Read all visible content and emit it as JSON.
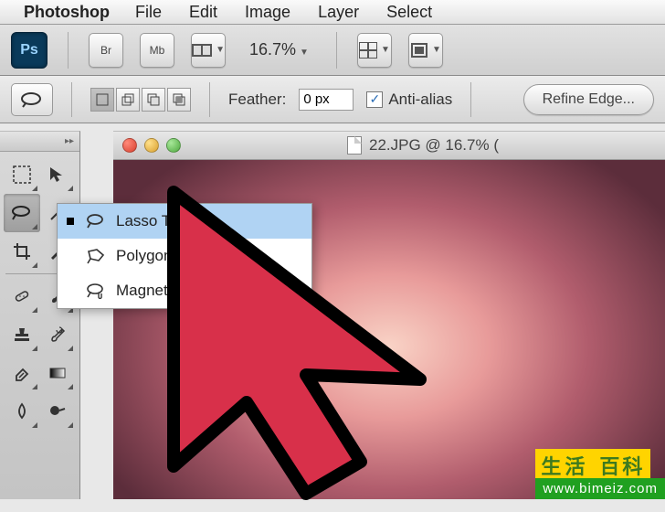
{
  "menubar": {
    "app": "Photoshop",
    "items": [
      "File",
      "Edit",
      "Image",
      "Layer",
      "Select"
    ]
  },
  "toolbar": {
    "ps_label": "Ps",
    "br_label": "Br",
    "mb_label": "Mb",
    "zoom": "16.7%"
  },
  "options": {
    "feather_label": "Feather:",
    "feather_value": "0 px",
    "antialias_label": "Anti-alias",
    "antialias_checked": "✓",
    "refine_label": "Refine Edge..."
  },
  "document": {
    "title": "22.JPG @ 16.7% ("
  },
  "flyout": {
    "items": [
      {
        "label": "Lasso Tool",
        "selected": true
      },
      {
        "label": "Polygonal Lasso",
        "selected": false
      },
      {
        "label": "Magnetic Lasso To",
        "selected": false
      }
    ]
  },
  "watermark": {
    "cn": "生活",
    "en": "百科",
    "url": "www.bimeiz.com"
  }
}
